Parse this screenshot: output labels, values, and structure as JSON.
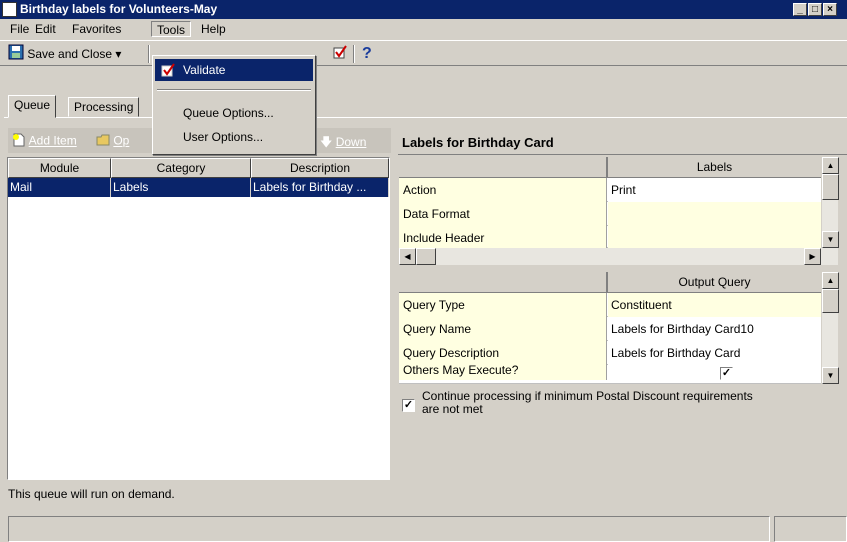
{
  "window": {
    "title": "Birthday labels for Volunteers-May"
  },
  "menu": [
    {
      "label": "File",
      "key": "F"
    },
    {
      "label": "Edit",
      "key": "E"
    },
    {
      "label": "Favorites",
      "key": "a"
    },
    {
      "label": "Tools",
      "key": "T"
    },
    {
      "label": "Help",
      "key": "H"
    }
  ],
  "toolbar": {
    "save_close_label": "Save and Close",
    "dropdown_arrow": "▾",
    "help_glyph": "?"
  },
  "tools_menu": [
    {
      "label": "Validate"
    },
    {
      "label": "Queue Options..."
    },
    {
      "label": "User Options..."
    }
  ],
  "tabs": [
    {
      "label": "Queue"
    },
    {
      "label": "Processing"
    }
  ],
  "queue_toolbar": {
    "add_item_label": "Add Item",
    "open_label": "Op",
    "down_label": "Down"
  },
  "queue_grid": {
    "columns": [
      "Module",
      "Category",
      "Description"
    ],
    "rows": [
      {
        "module": "Mail",
        "category": "Labels",
        "description": "Labels for Birthday ..."
      }
    ]
  },
  "right_panel": {
    "title": "Labels for Birthday Card",
    "labels_grid": {
      "header": "Labels",
      "rows": [
        {
          "name": "Action",
          "value": "Print"
        },
        {
          "name": "Data Format",
          "value": ""
        },
        {
          "name": "Include Header",
          "value": ""
        }
      ]
    },
    "output_grid": {
      "header": "Output Query",
      "rows": [
        {
          "name": "Query Type",
          "value": "Constituent"
        },
        {
          "name": "Query Name",
          "value": "Labels for Birthday Card10"
        },
        {
          "name": "Query Description",
          "value": "Labels for Birthday Card"
        },
        {
          "name": "Others May Execute?",
          "value": ""
        }
      ]
    },
    "continue_checkbox": {
      "checked": true,
      "label_line1": "Continue processing if minimum Postal Discount requirements",
      "label_line2": "are not met"
    }
  },
  "status_text": "This queue will run on demand.",
  "colors": {
    "title_bg": "#0a246a",
    "selection_bg": "#0a246a",
    "property_bg": "#ffffe1",
    "face": "#d4d0c8"
  },
  "icons": [
    "app-icon",
    "save-icon",
    "checkmark-icon",
    "help-icon",
    "add-item-icon",
    "open-icon",
    "down-arrow-icon",
    "scroll-up-icon",
    "scroll-down-icon",
    "scroll-left-icon",
    "scroll-right-icon"
  ]
}
